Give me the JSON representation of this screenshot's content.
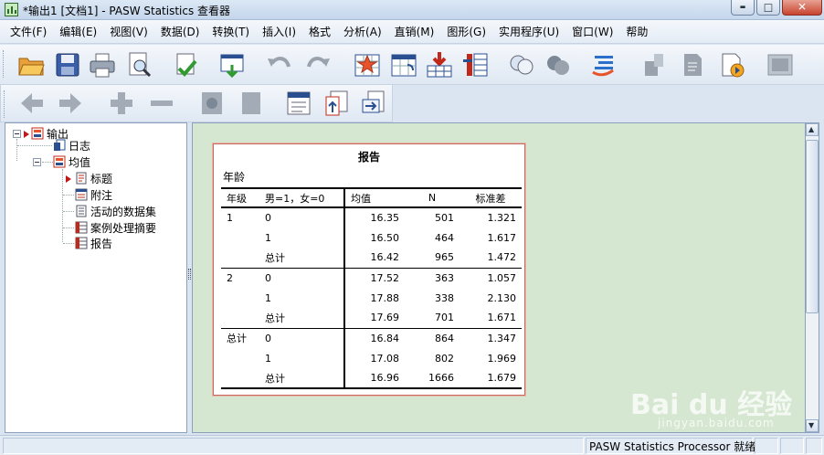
{
  "window": {
    "title": "*输出1 [文档1] - PASW Statistics 查看器",
    "minimize_glyph": "▬",
    "maximize_glyph": "□",
    "close_glyph": "✕"
  },
  "menu": {
    "items": [
      "文件(F)",
      "编辑(E)",
      "视图(V)",
      "数据(D)",
      "转换(T)",
      "插入(I)",
      "格式",
      "分析(A)",
      "直销(M)",
      "图形(G)",
      "实用程序(U)",
      "窗口(W)",
      "帮助"
    ]
  },
  "toolbar": {
    "row1_icons": [
      "open-folder-icon",
      "save-icon",
      "print-icon",
      "print-preview-icon",
      "export-icon",
      "recall-dialog-icon",
      "undo-icon",
      "redo-icon",
      "goto-case-icon",
      "goto-variable-icon",
      "insert-cases-icon",
      "insert-variable-icon",
      "value-labels-icon",
      "use-variable-sets-icon",
      "show-all-variables-icon",
      "spelling-icon",
      "run-script-icon",
      "designate-window-icon"
    ],
    "row2_icons": [
      "back-arrow-icon",
      "forward-arrow-icon",
      "expand-plus-icon",
      "collapse-minus-icon",
      "show-icon",
      "hide-icon",
      "insert-heading-icon",
      "insert-title-icon",
      "insert-text-icon"
    ]
  },
  "outline": {
    "root": "输出",
    "log": "日志",
    "means": "均值",
    "children": [
      "标题",
      "附注",
      "活动的数据集",
      "案例处理摘要",
      "报告"
    ]
  },
  "report": {
    "title": "报告",
    "subtitle": "年龄",
    "headers": [
      "年级",
      "男=1，女=0",
      "均值",
      "N",
      "标准差"
    ],
    "rows": [
      {
        "grade": "1",
        "gender": "0",
        "mean": "16.35",
        "n": "501",
        "sd": "1.321"
      },
      {
        "grade": "",
        "gender": "1",
        "mean": "16.50",
        "n": "464",
        "sd": "1.617"
      },
      {
        "grade": "",
        "gender": "总计",
        "mean": "16.42",
        "n": "965",
        "sd": "1.472"
      },
      {
        "grade": "2",
        "gender": "0",
        "mean": "17.52",
        "n": "363",
        "sd": "1.057"
      },
      {
        "grade": "",
        "gender": "1",
        "mean": "17.88",
        "n": "338",
        "sd": "2.130"
      },
      {
        "grade": "",
        "gender": "总计",
        "mean": "17.69",
        "n": "701",
        "sd": "1.671"
      },
      {
        "grade": "总计",
        "gender": "0",
        "mean": "16.84",
        "n": "864",
        "sd": "1.347"
      },
      {
        "grade": "",
        "gender": "1",
        "mean": "17.08",
        "n": "802",
        "sd": "1.969"
      },
      {
        "grade": "",
        "gender": "总计",
        "mean": "16.96",
        "n": "1666",
        "sd": "1.679"
      }
    ]
  },
  "status": {
    "processor": "PASW Statistics Processor 就绪"
  },
  "watermark": {
    "main": "Bai du 经验",
    "sub": "jingyan.baidu.com"
  },
  "colors": {
    "content_bg": "#d5e6d1",
    "report_border": "#c66a5c",
    "accent": "#c01818"
  }
}
